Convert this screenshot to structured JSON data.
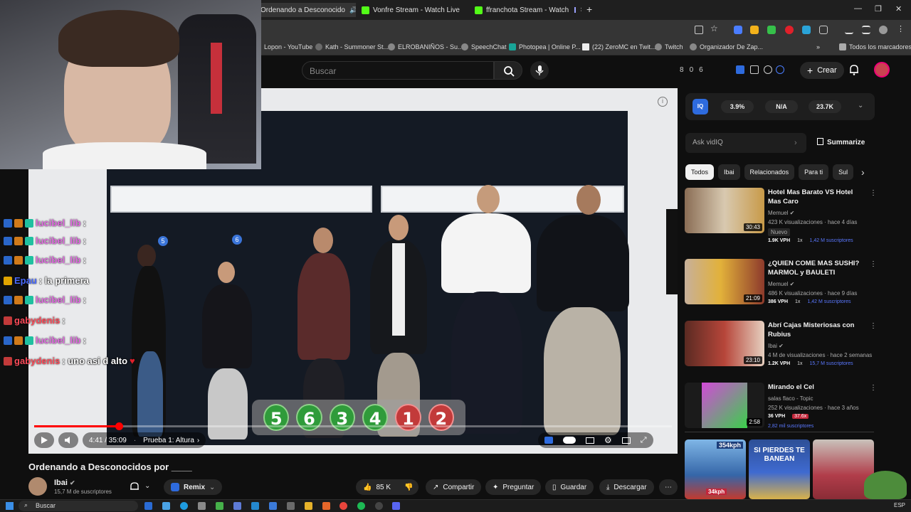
{
  "browser": {
    "tabs": [
      {
        "label": "Ordenando a Desconocido",
        "active": true
      },
      {
        "label": "Vonfre Stream - Watch Live",
        "active": false
      },
      {
        "label": "ffranchota Stream - Watch",
        "active": false
      }
    ],
    "new_tab": "+",
    "bookmarks": [
      "Lopon - YouTube",
      "Kath - Summoner St...",
      "ELROBANIÑOS - Su...",
      "SpeechChat",
      "Photopea | Online P...",
      "(22) ZeroMC en Twit...",
      "Twitch",
      "Organizador De Zap..."
    ],
    "all_bookmarks": "Todos los marcadores"
  },
  "youtube_header": {
    "search_placeholder": "Buscar",
    "counters": [
      "8",
      "0",
      "6"
    ],
    "create_label": "Crear"
  },
  "player": {
    "time": "4:41 / 35:09",
    "chapter": "Prueba 1: Altura",
    "progress_fraction": 0.133,
    "order_numbers": [
      {
        "n": "5",
        "color": "green"
      },
      {
        "n": "6",
        "color": "green"
      },
      {
        "n": "3",
        "color": "green"
      },
      {
        "n": "4",
        "color": "green"
      },
      {
        "n": "1",
        "color": "red"
      },
      {
        "n": "2",
        "color": "red"
      }
    ],
    "number_badges": [
      "5",
      "6"
    ]
  },
  "video": {
    "title": "Ordenando a Desconocidos por ____",
    "channel": "Ibai",
    "subscribers": "15,7 M de suscriptores",
    "remix": "Remix",
    "likes": "85 K",
    "share": "Compartir",
    "ask": "Preguntar",
    "save": "Guardar",
    "download": "Descargar"
  },
  "vidiq": {
    "logo": "IQ",
    "stats": [
      "3.9%",
      "N/A",
      "23.7K"
    ],
    "ask_placeholder": "Ask vidIQ",
    "summarize": "Summarize"
  },
  "chips": [
    "Todos",
    "Ibai",
    "Relacionados",
    "Para ti",
    "Sul"
  ],
  "recommendations": [
    {
      "title": "Hotel Mas Barato VS Hotel Mas Caro",
      "channel": "Memuel",
      "meta": "423 K visualizaciones · hace 4 días",
      "badge": "Nuevo",
      "duration": "30:43",
      "vph": "1.9K VPH",
      "mult": "1x",
      "subs": "1,42 M suscriptores"
    },
    {
      "title": "¿QUIEN COME MAS SUSHI? MARMOL y BAULETI",
      "channel": "Memuel",
      "meta": "486 K visualizaciones · hace 9 días",
      "badge": "",
      "duration": "21:09",
      "vph": "386 VPH",
      "mult": "1x",
      "subs": "1,42 M suscriptores"
    },
    {
      "title": "Abrí Cajas Misteriosas con Rubius",
      "channel": "Ibai",
      "meta": "4 M de visualizaciones · hace 2 semanas",
      "badge": "",
      "duration": "23:10",
      "vph": "1.2K VPH",
      "mult": "1x",
      "subs": "15,7 M suscriptores"
    },
    {
      "title": "Mirando el Cel",
      "channel": "salas flaco - Topic",
      "meta": "252 K visualizaciones · hace 3 años",
      "badge": "",
      "duration": "2:58",
      "vph": "36 VPH",
      "mult": "37.6x",
      "subs": "2,82 mil suscriptores"
    }
  ],
  "shorts": [
    {
      "top": "354kph",
      "bottom": "34kph"
    },
    {
      "top": "SI PIERDES TE BANEAN",
      "bottom": ""
    },
    {
      "top": "",
      "bottom": ""
    }
  ],
  "chat": [
    {
      "user": "lucibel_lib",
      "msg": ":",
      "color": "purple"
    },
    {
      "user": "lucibel_lib",
      "msg": ":",
      "color": "purple"
    },
    {
      "user": "lucibel_lib",
      "msg": ":",
      "color": "purple"
    },
    {
      "user": "Epau",
      "msg": ": la primera",
      "color": "blue"
    },
    {
      "user": "lucibel_lib",
      "msg": ":",
      "color": "purple"
    },
    {
      "user": "gabydenis",
      "msg": ":",
      "color": "red"
    },
    {
      "user": "lucibel_lib",
      "msg": ":",
      "color": "purple"
    },
    {
      "user": "gabydenis",
      "msg": ": uno asi d alto",
      "color": "red"
    }
  ],
  "taskbar": {
    "search": "Buscar",
    "tray": "ESP"
  },
  "colors": {
    "youtube_bg": "#0f0f0f",
    "accent_red": "#ff0000",
    "vidiq_blue": "#2e6bde",
    "green_order": "#2f9b3a",
    "red_order": "#c23a3a"
  }
}
